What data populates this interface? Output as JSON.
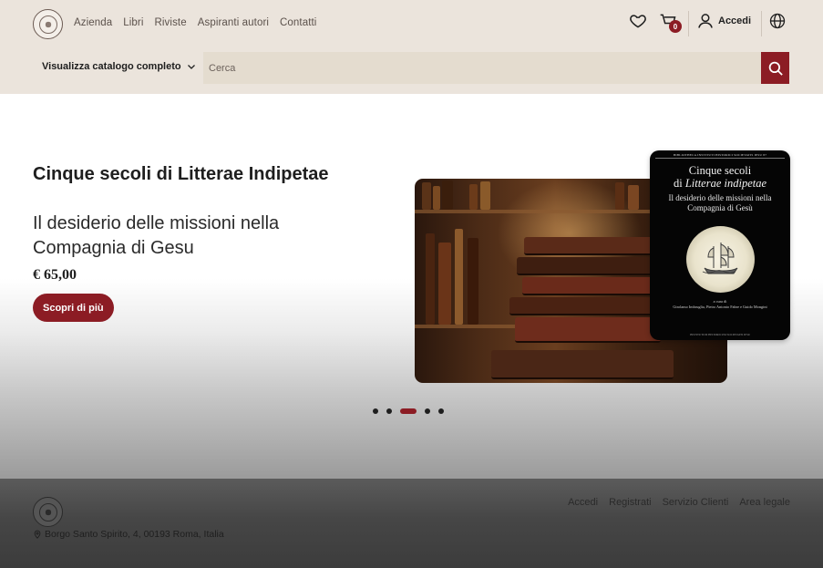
{
  "header": {
    "nav": [
      "Azienda",
      "Libri",
      "Riviste",
      "Aspiranti autori",
      "Contatti"
    ],
    "cart_count": "0",
    "login_label": "Accedi",
    "catalog_label": "Visualizza catalogo completo",
    "search_placeholder": "Cerca"
  },
  "hero": {
    "title": "Cinque secoli di Litterae Indipetae",
    "subtitle": "Il desiderio delle missioni nella Compagnia di Gesu",
    "price": "€ 65,00",
    "cta_label": "Scopri di più",
    "cover": {
      "series": "BIBLIOTHECA INSTITUTI HISTORICI SOCIETATIS IESU 87",
      "title_line1": "Cinque secoli",
      "title_di": "di",
      "title_italic": "Litterae indipetae",
      "subtitle": "Il desiderio delle missioni nella Compagnia di Gesù",
      "credit_a_cura": "a cura di",
      "credit_names": "Girolamo Imbruglia, Pietro Antonio Fabre e Guido Mongini",
      "publisher": "INSTITUTUM HISTORICUM SOCIETATIS IESU"
    },
    "slides": 5,
    "active_slide": 2
  },
  "footer": {
    "links": [
      "Accedi",
      "Registrati",
      "Servizio Clienti",
      "Area legale"
    ],
    "address": "Borgo Santo Spirito, 4, 00193 Roma, Italia"
  },
  "colors": {
    "accent": "#8c1c24",
    "header_bg": "#ebe4dc",
    "search_bg": "#e4dccf",
    "footer_bg": "#464646"
  },
  "icons": [
    "logo-seal",
    "heart-icon",
    "cart-icon",
    "user-icon",
    "globe-icon",
    "chevron-down-icon",
    "search-icon",
    "location-pin-icon"
  ]
}
